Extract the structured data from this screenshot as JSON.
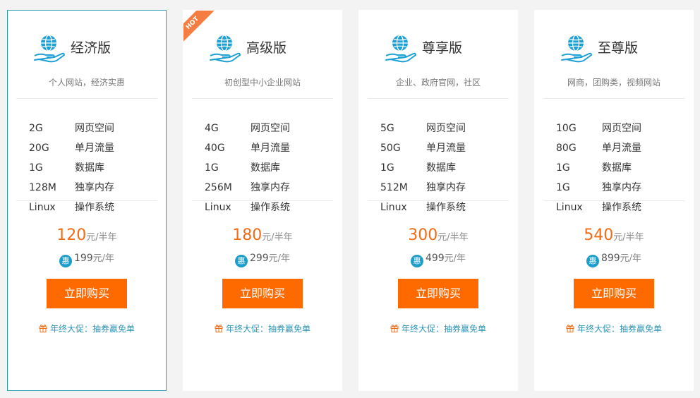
{
  "plans": [
    {
      "name": "经济版",
      "subtitle": "个人网站，经济实惠",
      "specs": [
        {
          "value": "2G",
          "label": "网页空间"
        },
        {
          "value": "20G",
          "label": "单月流量"
        },
        {
          "value": "1G",
          "label": "数据库"
        },
        {
          "value": "128M",
          "label": "独享内存"
        },
        {
          "value": "Linux",
          "label": "操作系统"
        }
      ],
      "price": "120",
      "price_unit": "元/半年",
      "promo_badge": "惠",
      "promo_price": "199",
      "promo_unit": "元/年",
      "buy_label": "立即购买",
      "footer_promo": "年终大促：抽券赢免单"
    },
    {
      "name": "高级版",
      "badge": "HOT",
      "subtitle": "初创型中小企业网站",
      "specs": [
        {
          "value": "4G",
          "label": "网页空间"
        },
        {
          "value": "40G",
          "label": "单月流量"
        },
        {
          "value": "1G",
          "label": "数据库"
        },
        {
          "value": "256M",
          "label": "独享内存"
        },
        {
          "value": "Linux",
          "label": "操作系统"
        }
      ],
      "price": "180",
      "price_unit": "元/半年",
      "promo_badge": "惠",
      "promo_price": "299",
      "promo_unit": "元/年",
      "buy_label": "立即购买",
      "footer_promo": "年终大促：抽券赢免单"
    },
    {
      "name": "尊享版",
      "subtitle": "企业、政府官网，社区",
      "specs": [
        {
          "value": "5G",
          "label": "网页空间"
        },
        {
          "value": "50G",
          "label": "单月流量"
        },
        {
          "value": "1G",
          "label": "数据库"
        },
        {
          "value": "512M",
          "label": "独享内存"
        },
        {
          "value": "Linux",
          "label": "操作系统"
        }
      ],
      "price": "300",
      "price_unit": "元/半年",
      "promo_badge": "惠",
      "promo_price": "499",
      "promo_unit": "元/年",
      "buy_label": "立即购买",
      "footer_promo": "年终大促：抽券赢免单"
    },
    {
      "name": "至尊版",
      "subtitle": "网商，团购类，视频网站",
      "specs": [
        {
          "value": "10G",
          "label": "网页空间"
        },
        {
          "value": "80G",
          "label": "单月流量"
        },
        {
          "value": "1G",
          "label": "数据库"
        },
        {
          "value": "1G",
          "label": "独享内存"
        },
        {
          "value": "Linux",
          "label": "操作系统"
        }
      ],
      "price": "540",
      "price_unit": "元/半年",
      "promo_badge": "惠",
      "promo_price": "899",
      "promo_unit": "元/年",
      "buy_label": "立即购买",
      "footer_promo": "年终大促：抽券赢免单"
    }
  ],
  "colors": {
    "accent_orange": "#ff6a00",
    "price_orange": "#f26b15",
    "promo_teal": "#2a93b3",
    "active_border": "#2a9fb3",
    "hot_ribbon": "#f57d42"
  },
  "icons": {
    "plan": "globe-in-hand-icon",
    "promo": "hui-badge-icon",
    "footer": "gift-icon"
  }
}
